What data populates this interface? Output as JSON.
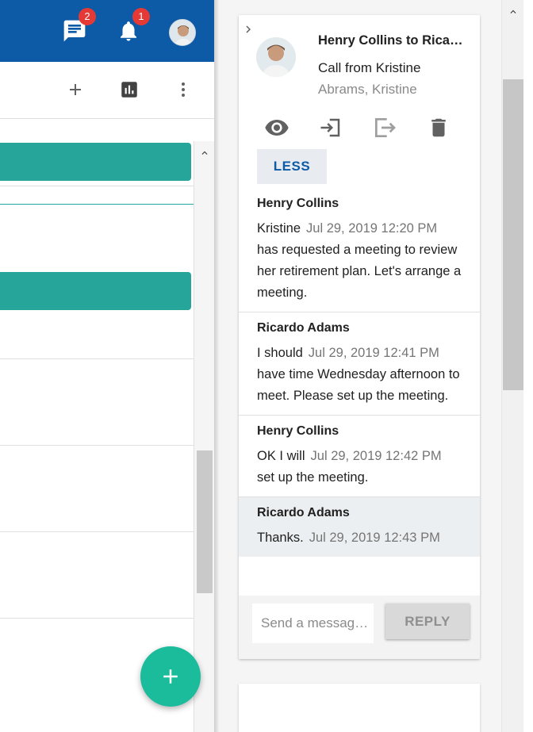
{
  "header": {
    "chat_badge": "2",
    "notification_badge": "1"
  },
  "card": {
    "title": "Henry Collins to Rica…",
    "subject": "Call from Kristine",
    "contact": "Abrams, Kristine",
    "less_label": "LESS"
  },
  "messages": [
    {
      "sender": "Henry Collins",
      "first_word": "Kristine",
      "timestamp": "Jul 29, 2019 12:20 PM",
      "rest": "has requested a meeting to review her retirement plan. Let's arrange a meeting."
    },
    {
      "sender": "Ricardo Adams",
      "first_word": "I should",
      "timestamp": "Jul 29, 2019 12:41 PM",
      "rest": "have time Wednesday afternoon to meet. Please set up the meeting."
    },
    {
      "sender": "Henry Collins",
      "first_word": "OK I will",
      "timestamp": "Jul 29, 2019 12:42 PM",
      "rest": "set up the meeting."
    },
    {
      "sender": "Ricardo Adams",
      "first_word": "Thanks.",
      "timestamp": "Jul 29, 2019 12:43 PM",
      "rest": ""
    }
  ],
  "reply": {
    "placeholder": "Send a messag…",
    "button_label": "REPLY"
  },
  "colors": {
    "topbar": "#0d5aa7",
    "accent_teal": "#26a69a",
    "fab": "#1abc9c",
    "badge": "#e53935"
  },
  "icons": [
    "chat-icon",
    "bell-icon",
    "avatar",
    "add-icon",
    "chart-icon",
    "more-vert-icon",
    "eye-icon",
    "sign-in-icon",
    "sign-out-icon",
    "trash-icon",
    "chevron-right-icon",
    "chevron-up-icon",
    "plus-icon"
  ]
}
